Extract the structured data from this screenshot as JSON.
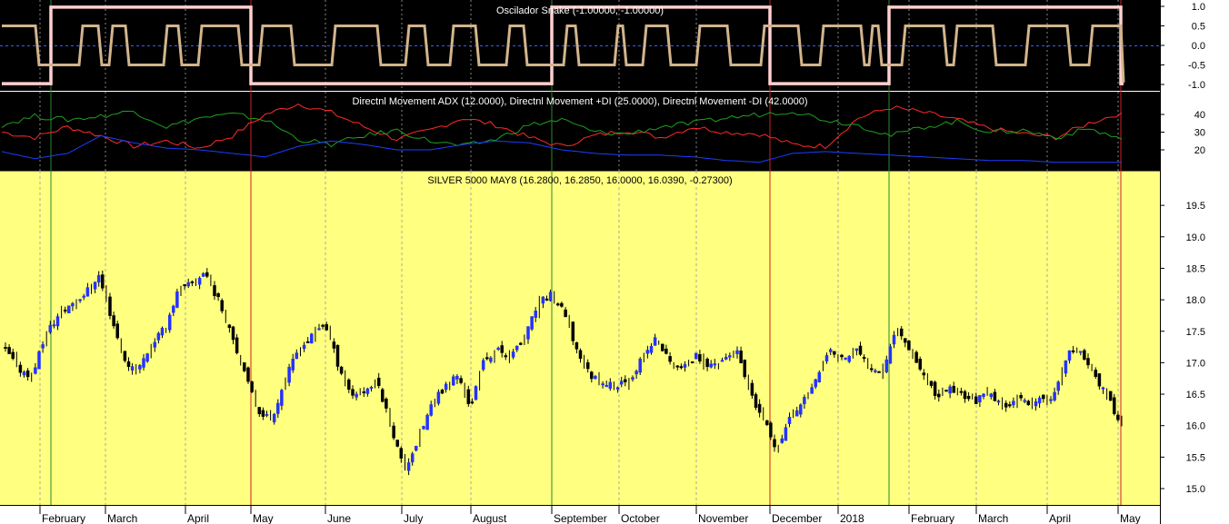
{
  "chart_data": [
    {
      "type": "line",
      "title": "Oscilador Snake (-1.00000, -1.00000)",
      "ylim": [
        -1.0,
        1.0
      ],
      "yticks": [
        "1.0",
        "0.5",
        "0.0",
        "-0.5",
        "-1.0"
      ],
      "series": [
        {
          "color": "#ffd0d0",
          "style": "step",
          "regime": [
            {
              "start": "Jan-2017",
              "end": "Feb-2017",
              "value": -1
            },
            {
              "start": "Feb-2017",
              "end": "May-2017",
              "value": 1
            },
            {
              "start": "May-2017",
              "end": "Sep-2017",
              "value": -1
            },
            {
              "start": "Sep-2017",
              "end": "Dec-2017",
              "value": 1
            },
            {
              "start": "Dec-2017",
              "end": "Jan-2018",
              "value": -1
            },
            {
              "start": "Jan-2018",
              "end": "May-2018",
              "value": 1
            },
            {
              "start": "May-2018",
              "end": "May-2018",
              "value": -1
            }
          ]
        },
        {
          "color": "#d2b48c",
          "style": "oscillating",
          "values": [
            -0.5,
            0.5
          ]
        }
      ]
    },
    {
      "type": "line",
      "title": "Directnl Movement ADX (12.0000), Directnl Movement +DI (25.0000), Directnl Movement -DI (42.0000)",
      "ylim": [
        10,
        50
      ],
      "yticks": [
        "40",
        "30",
        "20"
      ],
      "series": [
        {
          "color": "#ff2a2a",
          "values": [
            30,
            27,
            33,
            28,
            22,
            25,
            21,
            28,
            40,
            46,
            41,
            33,
            26,
            31,
            38,
            34,
            27,
            22,
            28,
            31,
            27,
            33,
            30,
            29,
            23,
            22,
            38,
            44,
            41,
            37,
            32,
            29,
            27,
            35,
            41
          ]
        },
        {
          "color": "#1f9f1f",
          "values": [
            34,
            39,
            37,
            39,
            42,
            33,
            38,
            40,
            37,
            26,
            23,
            28,
            31,
            25,
            22,
            26,
            34,
            37,
            30,
            29,
            33,
            35,
            38,
            40,
            42,
            37,
            34,
            28,
            33,
            36,
            30,
            31,
            27,
            32,
            26
          ]
        },
        {
          "color": "#1a3fff",
          "values": [
            19,
            15,
            18,
            28,
            24,
            21,
            20,
            18,
            16,
            22,
            25,
            23,
            20,
            20,
            23,
            25,
            24,
            20,
            18,
            17,
            17,
            16,
            14,
            13,
            18,
            19,
            18,
            17,
            16,
            15,
            14,
            14,
            13,
            13,
            13
          ]
        }
      ]
    },
    {
      "type": "candlestick",
      "title": "SILVER 5000 MAY8 (16.2800, 16.2850, 16.0000, 16.0390, -0.27300)",
      "ylim": [
        14.75,
        20.05
      ],
      "yticks": [
        "19.5",
        "19.0",
        "18.5",
        "18.0",
        "17.5",
        "17.0",
        "16.5",
        "16.0",
        "15.5",
        "15.0"
      ],
      "path": [
        17.2,
        16.9,
        16.8,
        17.45,
        17.75,
        17.95,
        18.1,
        18.4,
        17.7,
        17.0,
        16.9,
        17.3,
        17.55,
        18.15,
        18.25,
        18.45,
        18.0,
        17.5,
        16.8,
        16.25,
        16.1,
        16.7,
        17.2,
        17.4,
        17.65,
        17.0,
        16.5,
        16.55,
        16.7,
        16.0,
        15.3,
        15.75,
        16.3,
        16.6,
        16.8,
        16.3,
        17.05,
        17.2,
        17.1,
        17.35,
        17.9,
        18.1,
        17.8,
        17.2,
        16.8,
        16.7,
        16.6,
        16.75,
        17.1,
        17.4,
        17.0,
        16.9,
        17.1,
        16.95,
        17.05,
        17.2,
        16.5,
        16.1,
        15.65,
        16.1,
        16.4,
        16.7,
        17.2,
        17.05,
        17.2,
        16.95,
        16.9,
        17.55,
        17.25,
        16.85,
        16.45,
        16.6,
        16.5,
        16.4,
        16.5,
        16.3,
        16.45,
        16.3,
        16.4,
        16.5,
        17.2,
        17.15,
        16.8,
        16.4,
        16.05
      ]
    }
  ],
  "x_axis_labels": [
    "February",
    "March",
    "April",
    "May",
    "June",
    "July",
    "August",
    "September",
    "October",
    "November",
    "December",
    "2018",
    "February",
    "March",
    "April",
    "May"
  ]
}
